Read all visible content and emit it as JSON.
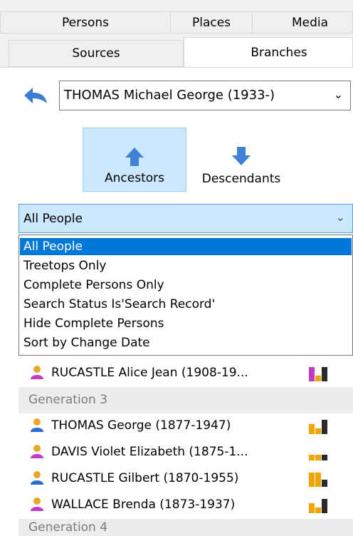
{
  "tabs": {
    "persons": "Persons",
    "places": "Places",
    "media": "Media",
    "sources": "Sources",
    "branches": "Branches"
  },
  "selector": {
    "person": "THOMAS Michael George (1933-)",
    "chevron": "⌄"
  },
  "direction": {
    "ancestors": "Ancestors",
    "descendants": "Descendants"
  },
  "filter": {
    "selected": "All People",
    "chevron": "⌄",
    "options": [
      "All People",
      "Treetops Only",
      "Complete Persons Only",
      "Search Status Is'Search Record'",
      "Hide Complete Persons",
      "Sort by Change Date"
    ]
  },
  "list": {
    "top_person": "RUCASTLE Alice Jean (1908-19...",
    "generation3": "Generation 3",
    "gen3_people": [
      "THOMAS George (1877-1947)",
      "DAVIS Violet Elizabeth (1875-1...",
      "RUCASTLE Gilbert (1870-1955)",
      "WALLACE Brenda (1873-1937)"
    ],
    "generation4": "Generation 4"
  },
  "colors": {
    "male": "#2b6cd1",
    "female": "#c03cc8",
    "selection": "#0078d7",
    "highlight": "#cce8ff"
  }
}
